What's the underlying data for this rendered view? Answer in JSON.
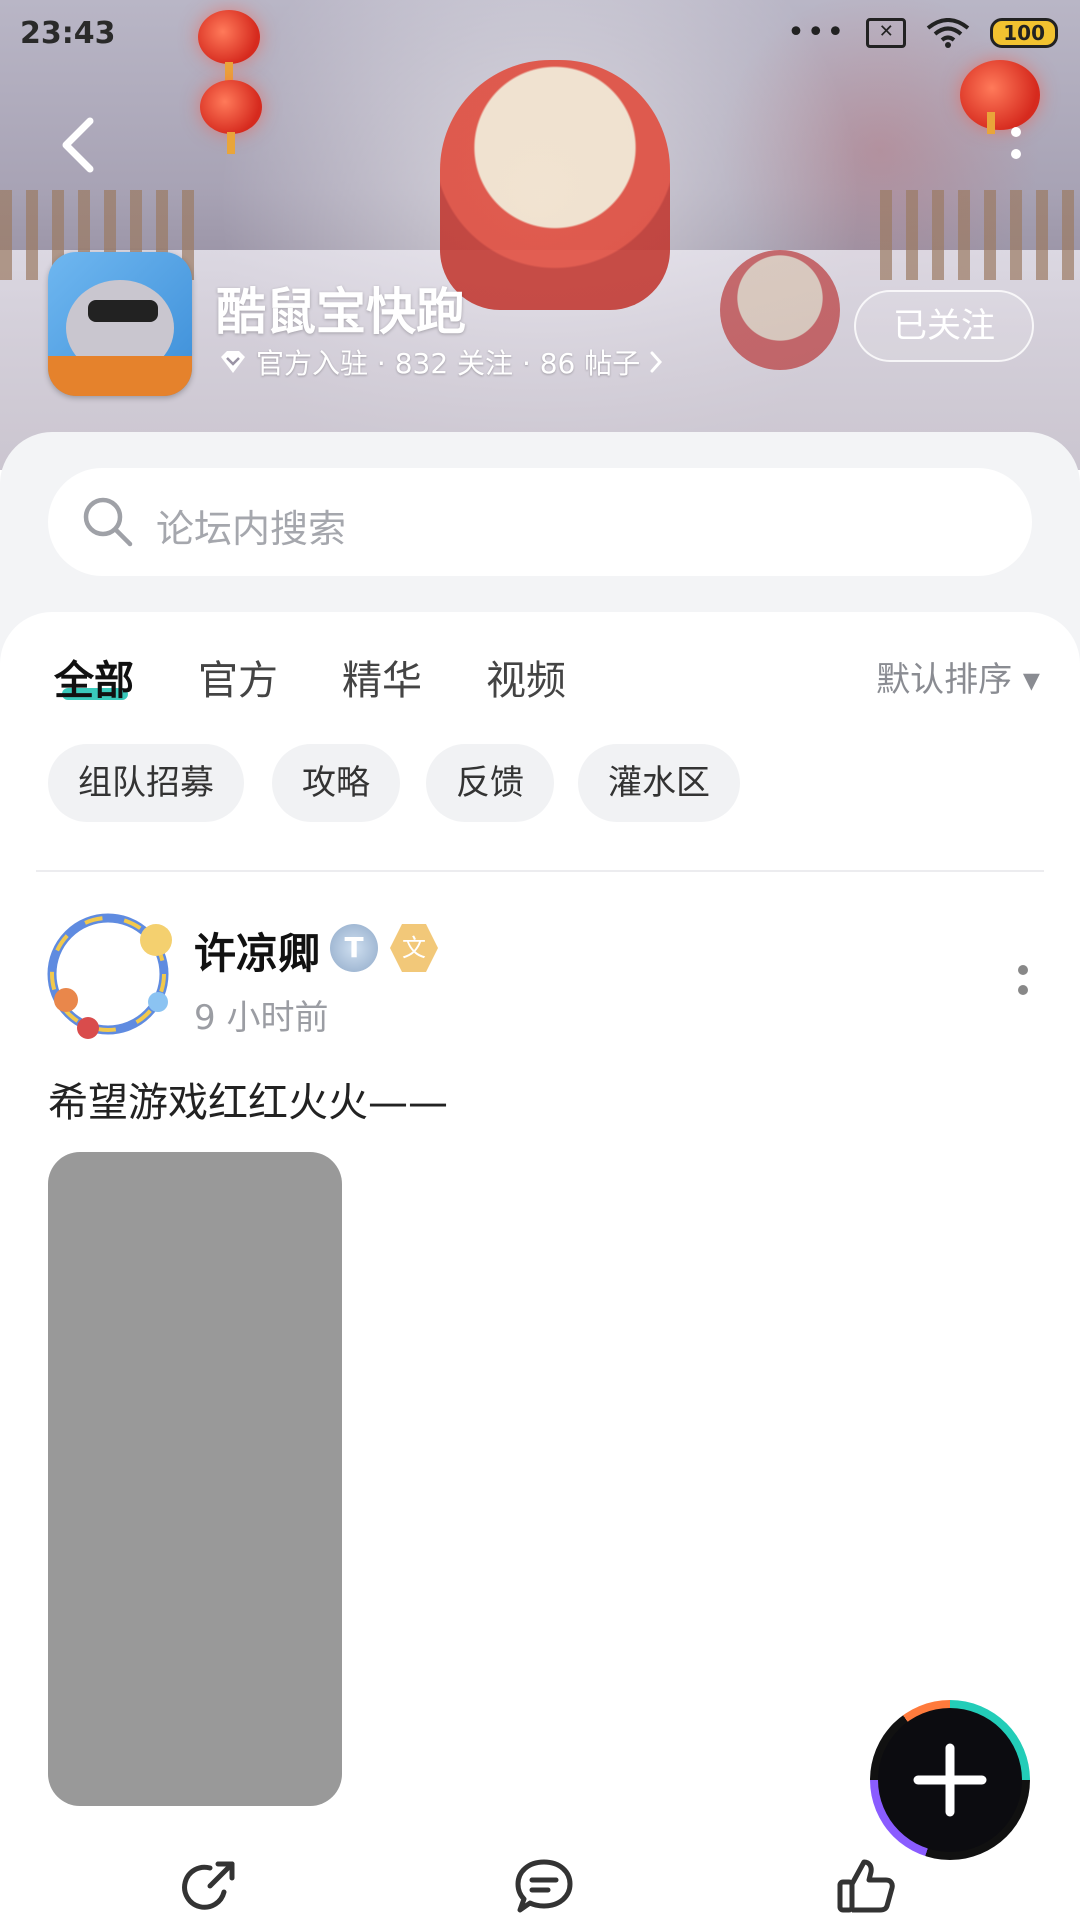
{
  "status_bar": {
    "time": "23:43",
    "more": "•••",
    "sim_icon": "✕",
    "battery": "100"
  },
  "header": {
    "forum_name": "酷鼠宝快跑",
    "meta": "官方入驻 · 832 关注 · 86 帖子",
    "follow_label": "已关注",
    "icons": [
      "back-arrow-icon",
      "more-vertical-icon",
      "verified-diamond-icon",
      "chevron-right-icon"
    ]
  },
  "search": {
    "placeholder": "论坛内搜索"
  },
  "tabs": [
    {
      "label": "全部",
      "active": true
    },
    {
      "label": "官方",
      "active": false
    },
    {
      "label": "精华",
      "active": false
    },
    {
      "label": "视频",
      "active": false
    }
  ],
  "sort": {
    "label": "默认排序 ▾"
  },
  "chips": [
    "组队招募",
    "攻略",
    "反馈",
    "灌水区"
  ],
  "post": {
    "author": "许凉卿",
    "badge_level": "T",
    "badge_emblem": "文",
    "time": "9 小时前",
    "text": "希望游戏红红火火——"
  },
  "fab": {
    "icon": "plus-icon"
  },
  "actions": [
    "share-icon",
    "comment-icon",
    "like-icon"
  ],
  "colors": {
    "accent": "#25c4b5",
    "image_placeholder": "#999999",
    "chip_bg": "#f1f2f4"
  }
}
